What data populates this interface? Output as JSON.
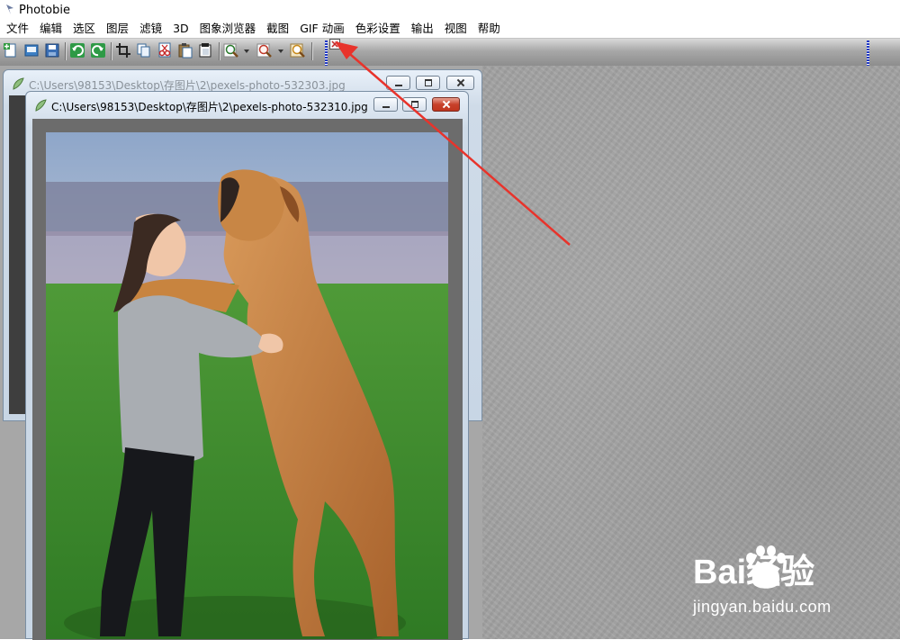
{
  "app": {
    "title": "Photobie"
  },
  "menu": [
    "文件",
    "编辑",
    "选区",
    "图层",
    "滤镜",
    "3D",
    "图象浏览器",
    "截图",
    "GIF 动画",
    "色彩设置",
    "输出",
    "视图",
    "帮助"
  ],
  "toolbar": {
    "buttons": [
      "new-icon",
      "open-icon",
      "save-icon",
      "undo-icon",
      "redo-icon",
      "crop-icon",
      "copy-icon",
      "cut-icon",
      "paste-icon",
      "paste-new-icon",
      "zoom-in-icon",
      "zoom-out-icon",
      "zoom-fit-icon"
    ]
  },
  "windows": {
    "back": {
      "title": "C:\\Users\\98153\\Desktop\\存图片\\2\\pexels-photo-532303.jpg"
    },
    "front": {
      "title": "C:\\Users\\98153\\Desktop\\存图片\\2\\pexels-photo-532310.jpg"
    }
  },
  "photo": {
    "subject": "girl-hugging-dog-icon"
  },
  "annotation": {
    "color": "#e8332b"
  },
  "watermark": {
    "brand": "Bai经验",
    "url": "jingyan.baidu.com"
  }
}
